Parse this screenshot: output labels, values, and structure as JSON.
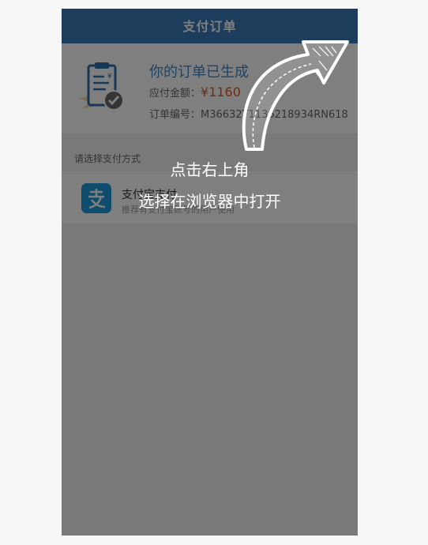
{
  "header": {
    "title": "支付订单"
  },
  "order": {
    "title": "你的订单已生成",
    "amount_label": "应付金额：",
    "amount_value": "¥1160",
    "order_no_label": "订单编号：",
    "order_no_value": "M36632T1136218934RN618",
    "icon": "clipboard-check-icon"
  },
  "payment": {
    "section_label": "请选择支付方式",
    "method": {
      "name": "支付宝支付",
      "description": "推荐有支付宝账号的用户使用",
      "icon": "alipay-icon",
      "color": "#1d9bdb"
    }
  },
  "overlay": {
    "line1": "点击右上角",
    "line2": "选择在浏览器中打开",
    "icon": "curved-arrow-up-right-icon"
  },
  "colors": {
    "header_bg": "#3a7ab8",
    "title_blue": "#3a86c8",
    "amount_red": "#e0541f",
    "overlay": "rgba(0,0,0,0.5)"
  }
}
